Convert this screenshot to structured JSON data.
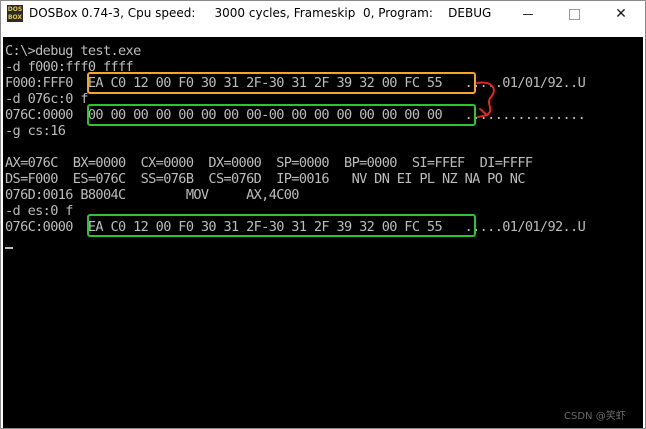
{
  "window": {
    "title": "DOSBox 0.74-3, Cpu speed:     3000 cycles, Frameskip  0, Program:    DEBUG",
    "icon_text": "DOS BOX",
    "min_glyph": "—",
    "close_glyph": "✕"
  },
  "terminal": {
    "lines": [
      "C:\\>debug test.exe",
      "-d f000:fff0 ffff",
      "F000:FFF0  EA C0 12 00 F0 30 31 2F-30 31 2F 39 32 00 FC 55   .....01/01/92..U",
      "-d 076c:0 f",
      "076C:0000  00 00 00 00 00 00 00 00-00 00 00 00 00 00 00 00   ................",
      "-g cs:16",
      "",
      "AX=076C  BX=0000  CX=0000  DX=0000  SP=0000  BP=0000  SI=FFEF  DI=FFFF",
      "DS=F000  ES=076C  SS=076B  CS=076D  IP=0016   NV DN EI PL NZ NA PO NC",
      "076D:0016 B8004C        MOV     AX,4C00",
      "-d es:0 f",
      "076C:0000  EA C0 12 00 F0 30 31 2F-30 31 2F 39 32 00 FC 55   .....01/01/92..U"
    ]
  },
  "annotations": {
    "highlight_top_color": "#f5a623",
    "highlight_other_color": "#2ec42e",
    "arrow_color": "#e8261f"
  },
  "watermark": "CSDN @笑虾"
}
